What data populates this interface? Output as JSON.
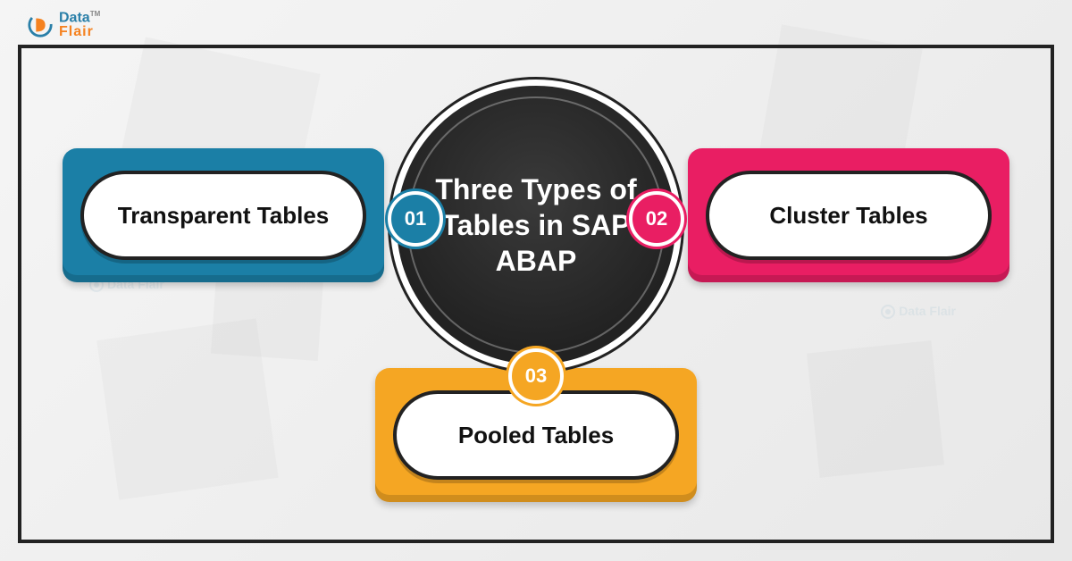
{
  "logo": {
    "line1": "Data",
    "line2": "Flair",
    "tm": "TM"
  },
  "center_title": "Three Types of Tables in SAP ABAP",
  "cards": {
    "left": {
      "label": "Transparent Tables",
      "number": "01"
    },
    "right": {
      "label": "Cluster Tables",
      "number": "02"
    },
    "bottom": {
      "label": "Pooled Tables",
      "number": "03"
    }
  },
  "watermark_text": "Data Flair",
  "colors": {
    "card_left": "#1b7fa6",
    "card_right": "#e91e63",
    "card_bottom": "#f5a623",
    "center": "#222222"
  },
  "chart_data": {
    "type": "diagram",
    "title": "Three Types of Tables in SAP ABAP",
    "items": [
      {
        "order": 1,
        "label": "Transparent Tables",
        "color": "#1b7fa6"
      },
      {
        "order": 2,
        "label": "Cluster Tables",
        "color": "#e91e63"
      },
      {
        "order": 3,
        "label": "Pooled Tables",
        "color": "#f5a623"
      }
    ]
  }
}
